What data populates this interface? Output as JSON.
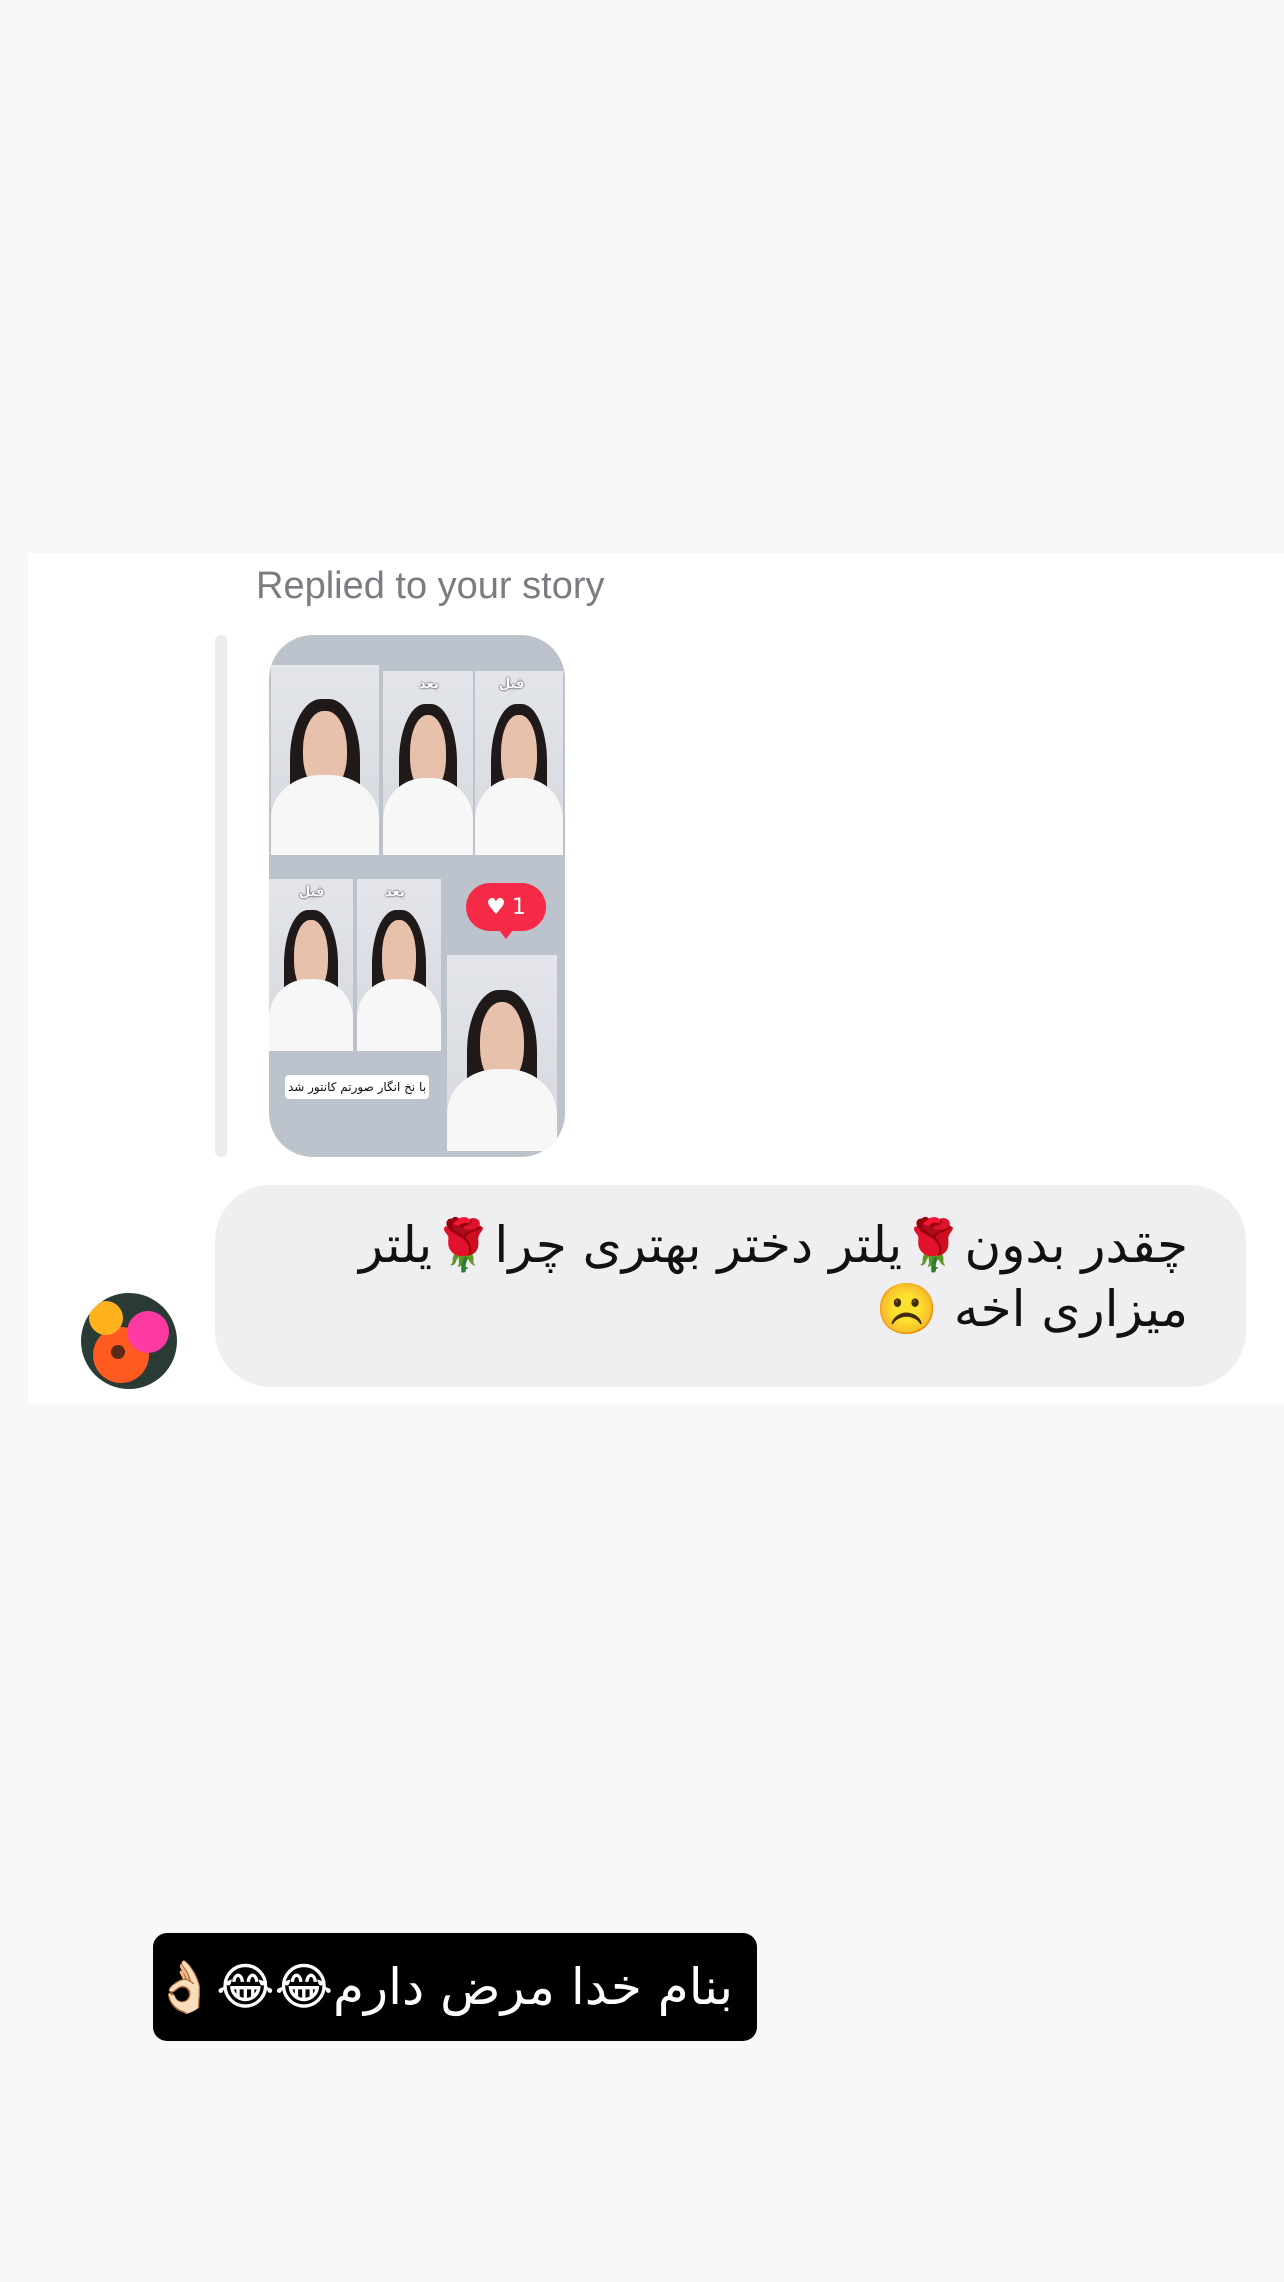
{
  "conversation": {
    "reply_context": "Replied to your story",
    "story": {
      "labels": {
        "top_before": "قبل",
        "top_after": "بعد",
        "bottom_before": "قبل",
        "bottom_after": "بعد"
      },
      "like_count": "1",
      "caption": "با نخ انگار صورتم کانتور شد"
    },
    "message": "چقدر بدون🌹یلتر دختر بهتری چرا🌹یلتر میزاری اخه ☹️"
  },
  "overlay_caption": "بنام خدا مرض دارم😂😂👌🏻",
  "colors": {
    "background": "#f8f8fa",
    "card": "#ffffff",
    "bubble": "#efeff2",
    "like": "#f52a47"
  },
  "icons": {
    "like": "heart-icon",
    "avatar": "flower-avatar"
  }
}
